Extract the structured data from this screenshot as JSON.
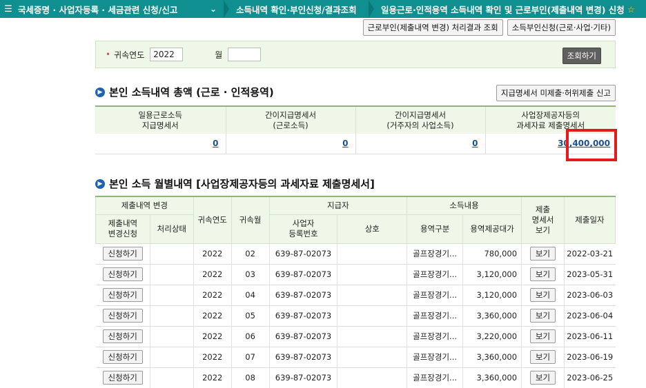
{
  "breadcrumb": {
    "menu_icon": "menu-icon",
    "item1": "국세증명 · 사업자등록 · 세금관련 신청/신고",
    "item2": "소득내역 확인·부인신청/결과조회",
    "item3": "일용근로·인적용역 소득내역 확인 및 근로부인(제출내역 변경) 신청",
    "star": "☆"
  },
  "top_buttons": {
    "result_query": "근로부인(제출내역 변경) 처리결과 조회",
    "deny_request": "소득부인신청(근로·사업·기타)"
  },
  "search": {
    "year_label": "귀속연도",
    "year_value": "2022",
    "month_label": "월",
    "month_value": "",
    "query_button": "조회하기"
  },
  "summary": {
    "title": "본인 소득내역 총액  (근로 · 인적용역)",
    "report_button": "지급명세서 미제출·허위제출 신고",
    "headers": [
      [
        "일용근로소득",
        "지급명세서"
      ],
      [
        "간이지급명세서",
        "(근로소득)"
      ],
      [
        "간이지급명세서",
        "(거주자의 사업소득)"
      ],
      [
        "사업장제공자등의",
        "과세자료 제출명세서"
      ]
    ],
    "values": [
      "0",
      "0",
      "0",
      "30,400,000"
    ]
  },
  "monthly": {
    "title": "본인 소득 월별내역 [사업장제공자등의 과세자료 제출명세서]",
    "headers": {
      "change_group": "제출내역 변경",
      "change_request": [
        "제출내역",
        "변경신청"
      ],
      "status": "처리상태",
      "year": "귀속연도",
      "month": "귀속월",
      "payer_group": "지급자",
      "biz_no": [
        "사업자",
        "등록번호"
      ],
      "company": "상호",
      "income_group": "소득내용",
      "service_type": "용역구분",
      "service_amount": "용역제공대가",
      "view": [
        "제출",
        "명세서",
        "보기"
      ],
      "submit_date": "제출일자"
    },
    "request_label": "신청하기",
    "view_label": "보기",
    "rows": [
      {
        "year": "2022",
        "month": "02",
        "biz_no": "639-87-02073",
        "service": "골프장경기...",
        "amount": "780,000",
        "date": "2022-03-21"
      },
      {
        "year": "2022",
        "month": "03",
        "biz_no": "639-87-02073",
        "service": "골프장경기...",
        "amount": "3,120,000",
        "date": "2023-05-31"
      },
      {
        "year": "2022",
        "month": "04",
        "biz_no": "639-87-02073",
        "service": "골프장경기...",
        "amount": "3,120,000",
        "date": "2023-06-03"
      },
      {
        "year": "2022",
        "month": "05",
        "biz_no": "639-87-02073",
        "service": "골프장경기...",
        "amount": "3,360,000",
        "date": "2023-06-04"
      },
      {
        "year": "2022",
        "month": "06",
        "biz_no": "639-87-02073",
        "service": "골프장경기...",
        "amount": "3,220,000",
        "date": "2023-06-11"
      },
      {
        "year": "2022",
        "month": "07",
        "biz_no": "639-87-02073",
        "service": "골프장경기...",
        "amount": "3,360,000",
        "date": "2023-06-19"
      },
      {
        "year": "2022",
        "month": "08",
        "biz_no": "639-87-02073",
        "service": "골프장경기...",
        "amount": "3,360,000",
        "date": "2023-06-25"
      }
    ]
  },
  "colors": {
    "topbar": "#0f8f8f",
    "highlight": "#e31b1b",
    "section_dot": "#1f62b0"
  }
}
